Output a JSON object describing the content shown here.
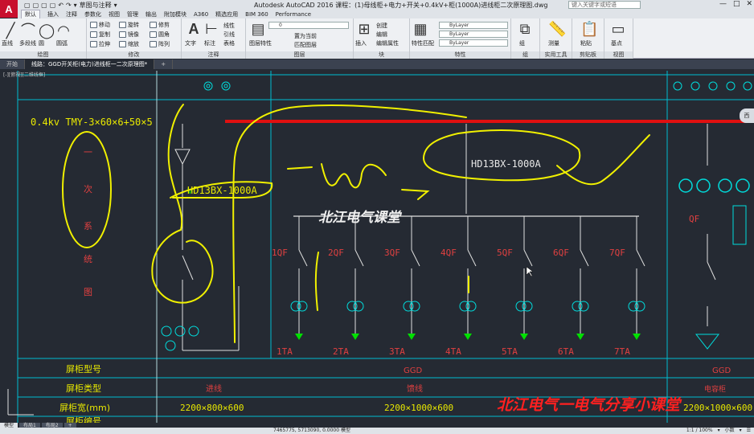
{
  "app": {
    "logo": "A",
    "title": "Autodesk AutoCAD 2016   课程：(1)母线柜+电力+开关+0.4kV+柜(1000A)进线柜二次原理图.dwg",
    "qat": [
      "▢",
      "▢",
      "▢",
      "▢",
      "↶",
      "↷",
      "▾",
      "草图与注释",
      "▾"
    ],
    "search_placeholder": "键入关键字或短语",
    "win_controls": [
      "—",
      "□",
      "✕"
    ]
  },
  "ribbon_tabs": [
    "默认",
    "插入",
    "注释",
    "参数化",
    "视图",
    "管理",
    "输出",
    "附加模块",
    "A360",
    "精选应用",
    "BIM 360",
    "Performance"
  ],
  "active_tab": "默认",
  "panels": [
    {
      "name": "绘图",
      "tools": [
        "直线",
        "多段线",
        "圆",
        "圆弧"
      ]
    },
    {
      "name": "修改",
      "tools": [
        "移动",
        "旋转",
        "修剪",
        "复制",
        "镜像",
        "圆角",
        "拉伸",
        "缩放",
        "阵列"
      ]
    },
    {
      "name": "注释",
      "tools": [
        "文字",
        "标注",
        "线性",
        "引线",
        "表格"
      ]
    },
    {
      "name": "图层",
      "tools": [
        "图层特性",
        "置为当前",
        "匹配图层"
      ],
      "layer_value": "0"
    },
    {
      "name": "块",
      "tools": [
        "插入",
        "创建",
        "编辑",
        "编辑属性"
      ]
    },
    {
      "name": "特性",
      "tools": [
        "特性匹配"
      ],
      "combos": [
        "ByLayer",
        "ByLayer",
        "ByLayer"
      ]
    },
    {
      "name": "组",
      "tools": [
        "组"
      ]
    },
    {
      "name": "实用工具",
      "tools": [
        "测量"
      ]
    },
    {
      "name": "剪贴板",
      "tools": [
        "粘贴"
      ]
    },
    {
      "name": "视图",
      "tools": [
        "基点"
      ]
    }
  ],
  "file_tabs": [
    {
      "label": "开始",
      "active": false
    },
    {
      "label": "线路：GGD开关柜(电力)进线柜一二次原理图*",
      "active": true
    },
    {
      "label": "+",
      "active": false
    }
  ],
  "viewport_label": "[-][俯视][二维线框]",
  "viewcube_label": "西",
  "drawing": {
    "left_title": "0.4kv  TMY-3×60×6+50×5",
    "vertical_label": [
      "一",
      "次",
      "系",
      "统",
      "图"
    ],
    "incoming_breaker": "HD13BX-1000A",
    "main_breaker": "HD13BX-1000A",
    "watermark": "北江电气课堂",
    "branches": [
      {
        "qf": "1QF",
        "ta": "1TA"
      },
      {
        "qf": "2QF",
        "ta": "2TA"
      },
      {
        "qf": "3QF",
        "ta": "3TA"
      },
      {
        "qf": "4QF",
        "ta": "4TA"
      },
      {
        "qf": "5QF",
        "ta": "5TA"
      },
      {
        "qf": "6QF",
        "ta": "6TA"
      },
      {
        "qf": "7QF",
        "ta": "7TA"
      }
    ],
    "right_qf": "QF",
    "table": {
      "row_labels": [
        "屏柜型号",
        "屏柜类型",
        "屏柜宽(mm)",
        "屏柜编号"
      ],
      "col_a": {
        "model": "",
        "type": "进线",
        "size": "2200×800×600"
      },
      "col_b": {
        "model": "GGD",
        "type": "馈线",
        "size": "2200×1000×600"
      },
      "col_c": {
        "model": "GGD",
        "type": "电容柜",
        "size": "2200×1000×600"
      }
    },
    "bottom_watermark": "北江电气一电气分享小课堂"
  },
  "layout_tabs": [
    "模型",
    "布局1",
    "布局2",
    "+"
  ],
  "status": {
    "coords": "7465775, 5713090, 0.0000  模型",
    "right": [
      "1:1 / 100%",
      "▾",
      "小数",
      "▾",
      "☰"
    ]
  },
  "colors": {
    "accent_red": "#e01010",
    "yellow": "#e8e800",
    "green": "#00e000",
    "cyan": "#00dcdc"
  }
}
